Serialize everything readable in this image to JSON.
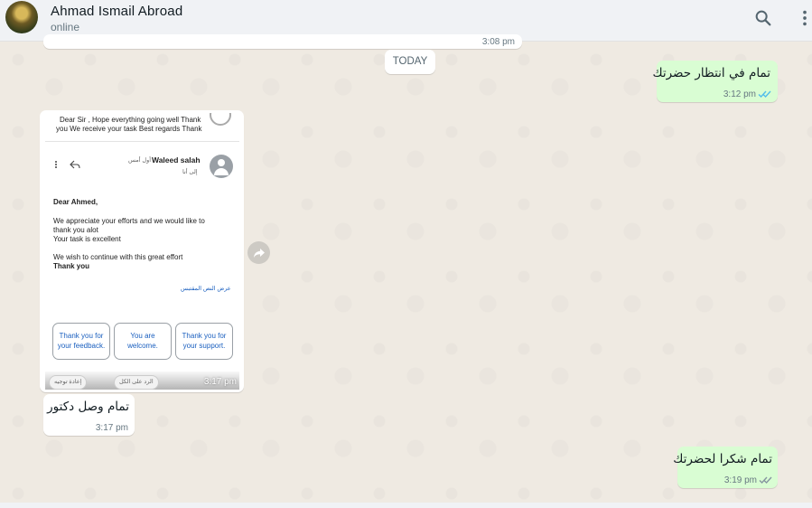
{
  "header": {
    "contact_name": "Ahmad Ismail Abroad",
    "status": "online",
    "search_icon": "search-icon",
    "menu_icon": "kebab-menu-icon"
  },
  "chat": {
    "prev_time": "3:08 pm",
    "date_chip": "TODAY",
    "messages": [
      {
        "direction": "outgoing",
        "text": "تمام في انتظار حضرتك",
        "time": "3:12 pm",
        "status": "read"
      },
      {
        "direction": "incoming",
        "type": "image",
        "time": "3:17 pm"
      },
      {
        "direction": "incoming",
        "text": "تمام وصل دكتور",
        "time": "3:17 pm"
      },
      {
        "direction": "outgoing",
        "text": "تمام شكرا لحضرتك",
        "time": "3:19 pm",
        "status": "delivered"
      }
    ]
  },
  "email_screenshot": {
    "preview_text_1": "Dear Sir , Hope everything going well Thank",
    "preview_text_2": "you We receive your task Best regards Thank",
    "sender": "Waleed salah",
    "sent_when": "أول أمس",
    "to_me": "إلى أنا",
    "greeting": "Dear Ahmed,",
    "line1": "We appreciate your efforts and we would like to",
    "line2": "thank you alot",
    "line3": "Your task is excellent",
    "line4": "We wish to continue with this great effort",
    "signoff": "Thank you",
    "show_quoted": "عرض النص المقتبس",
    "suggestions": [
      "Thank you for your feedback.",
      "You are welcome.",
      "Thank you for your support."
    ],
    "action_forward": "إعادة توجيه",
    "action_reply_all": "الرد على الكل"
  },
  "colors": {
    "outgoing_bubble": "#d9fdd3",
    "incoming_bubble": "#ffffff",
    "read_ticks": "#53bdeb",
    "delivered_ticks": "#8696a0",
    "wallpaper": "#efeae2"
  }
}
